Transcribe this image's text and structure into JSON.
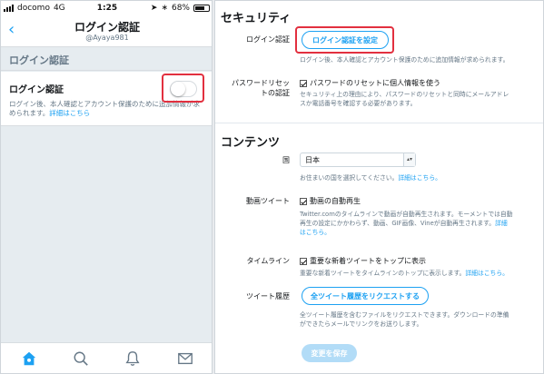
{
  "phone": {
    "status": {
      "carrier": "docomo",
      "network": "4G",
      "time": "1:25",
      "battery": "68%"
    },
    "nav": {
      "back_icon": "chevron-left-icon",
      "title": "ログイン認証",
      "subtitle": "@Ayaya981"
    },
    "section_header": "ログイン認証",
    "setting": {
      "label": "ログイン認証",
      "toggle_on": false,
      "description": "ログイン後、本人確認とアカウント保護のために追加情報が求められます。",
      "link": "詳細はこちら"
    },
    "tabs": [
      {
        "icon": "home-icon",
        "active": true
      },
      {
        "icon": "search-icon",
        "active": false
      },
      {
        "icon": "bell-icon",
        "active": false
      },
      {
        "icon": "mail-icon",
        "active": false
      }
    ]
  },
  "settings": {
    "security": {
      "heading": "セキュリティ",
      "login_auth": {
        "label": "ログイン認証",
        "button": "ログイン認証を設定",
        "help": "ログイン後、本人確認とアカウント保護のために追加情報が求められます。"
      },
      "password_reset": {
        "label_line1": "パスワードリセッ",
        "label_line2": "トの認証",
        "checkbox_label": "パスワードのリセットに個人情報を使う",
        "checked": true,
        "help_line1": "セキュリティ上の理由により、パスワードのリセットと同時にメールアドレ",
        "help_line2": "スか電話番号を確認する必要があります。"
      }
    },
    "content": {
      "heading": "コンテンツ",
      "country": {
        "label": "国",
        "value": "日本",
        "help": "お住まいの国を選択してください。",
        "link": "詳細はこちら。"
      },
      "video_tweets": {
        "label": "動画ツイート",
        "checkbox_label": "動画の自動再生",
        "checked": true,
        "help_line1": "Twitter.comのタイムラインで動画が自動再生されます。モーメントでは自動",
        "help_line2": "再生の設定にかかわらず、動画、GIF画像、Vineが自動再生されます。",
        "link_a": "詳細",
        "link_b": "はこちら。"
      },
      "timeline": {
        "label": "タイムライン",
        "checkbox_label": "重要な新着ツイートをトップに表示",
        "checked": true,
        "help": "重要な新着ツイートをタイムラインのトップに表示します。",
        "link": "詳細はこちら。"
      },
      "history": {
        "label": "ツイート履歴",
        "button": "全ツイート履歴をリクエストする",
        "help_line1": "全ツイート履歴を含むファイルをリクエストできます。ダウンロードの準備",
        "help_line2": "ができたらメールでリンクをお送りします。"
      },
      "save_button": "変更を保存"
    }
  },
  "colors": {
    "accent": "#1da1f2",
    "highlight": "#e2303f",
    "disabled": "#b2dcf7"
  }
}
